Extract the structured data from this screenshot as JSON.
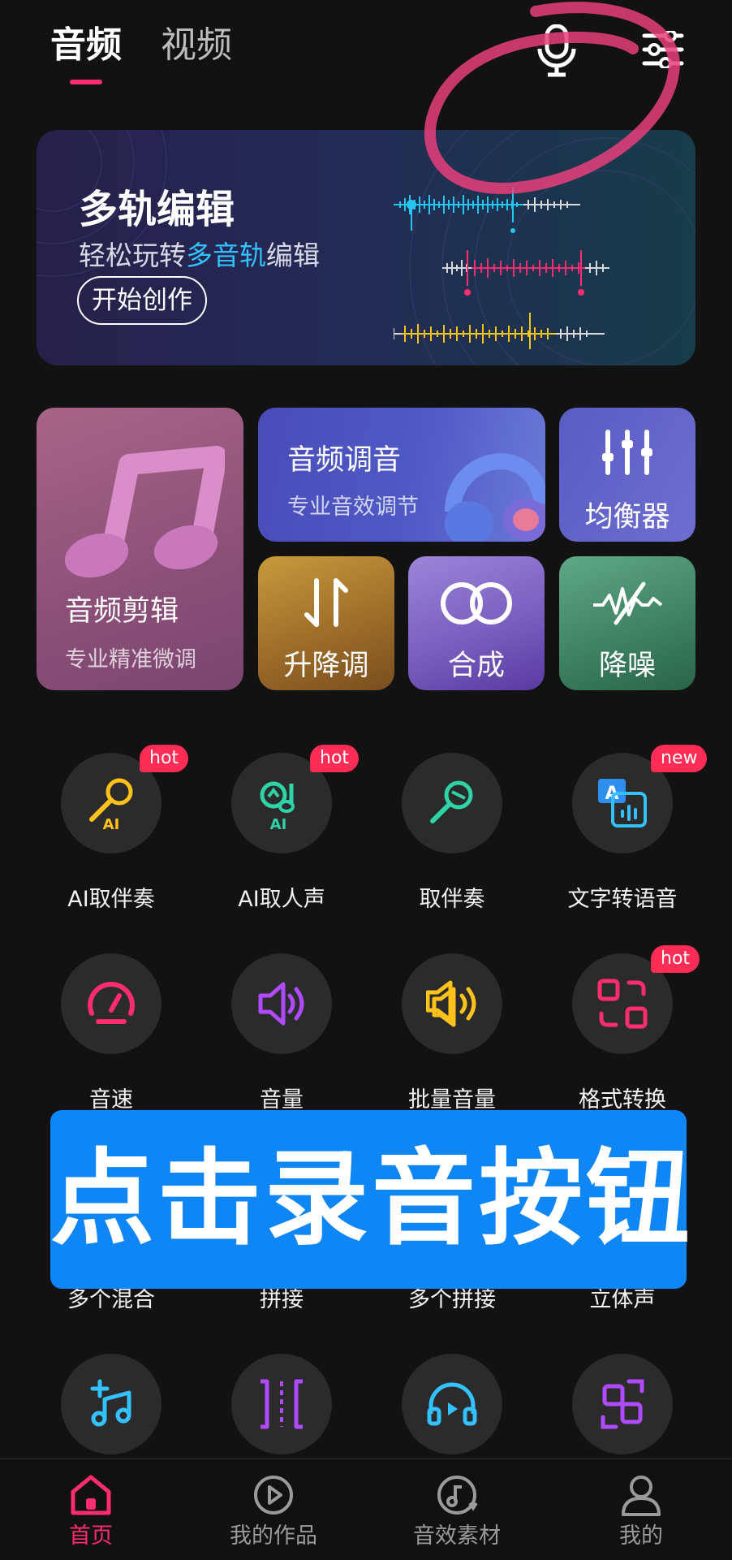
{
  "header": {
    "tabs": [
      {
        "label": "音频",
        "active": true
      },
      {
        "label": "视频",
        "active": false
      }
    ],
    "icons": [
      "microphone-icon",
      "settings-sliders-icon"
    ],
    "accent_color": "#ff2d6f",
    "annotation_circle_color": "#e8407a"
  },
  "banner": {
    "title": "多轨编辑",
    "subtitle_prefix": "轻松玩转",
    "subtitle_highlight": "多音轨",
    "subtitle_suffix": "编辑",
    "button_label": "开始创作",
    "track_colors": [
      "#27c6f0",
      "#ff2d6f",
      "#ffc21a"
    ]
  },
  "features": {
    "audio_edit": {
      "label": "音频剪辑",
      "sub": "专业精准微调"
    },
    "audio_tune": {
      "label": "音频调音",
      "sub": "专业音效调节"
    },
    "equalizer": {
      "label": "均衡器"
    },
    "pitch": {
      "label": "升降调"
    },
    "mix": {
      "label": "合成"
    },
    "denoise": {
      "label": "降噪"
    }
  },
  "tools": [
    {
      "label": "AI取伴奏",
      "badge": "hot",
      "icon": "ai-karaoke-mic-icon",
      "sub_icon_text": "AI"
    },
    {
      "label": "AI取人声",
      "badge": "hot",
      "icon": "ai-vocal-extract-icon",
      "sub_icon_text": "AI"
    },
    {
      "label": "取伴奏",
      "badge": "",
      "icon": "karaoke-mic-icon"
    },
    {
      "label": "文字转语音",
      "badge": "new",
      "icon": "text-to-speech-icon",
      "sub_icon_text": "A"
    },
    {
      "label": "音速",
      "badge": "",
      "icon": "speedometer-icon"
    },
    {
      "label": "音量",
      "badge": "",
      "icon": "volume-icon"
    },
    {
      "label": "批量音量",
      "badge": "",
      "icon": "batch-volume-icon"
    },
    {
      "label": "格式转换",
      "badge": "hot",
      "icon": "format-convert-icon"
    },
    {
      "label": "多个混合",
      "badge": "",
      "icon": "hidden"
    },
    {
      "label": "拼接",
      "badge": "",
      "icon": "hidden"
    },
    {
      "label": "多个拼接",
      "badge": "",
      "icon": "hidden"
    },
    {
      "label": "立体声",
      "badge": "",
      "icon": "hidden"
    },
    {
      "label": "",
      "badge": "",
      "icon": "add-music-icon"
    },
    {
      "label": "",
      "badge": "",
      "icon": "split-icon"
    },
    {
      "label": "",
      "badge": "",
      "icon": "headphone-play-icon"
    },
    {
      "label": "",
      "badge": "",
      "icon": "swap-convert-icon"
    }
  ],
  "overlay": {
    "text": "点击录音按钮",
    "color": "#0f86f5"
  },
  "bottom_nav": [
    {
      "label": "首页",
      "icon": "home-icon",
      "active": true
    },
    {
      "label": "我的作品",
      "icon": "play-circle-icon",
      "active": false
    },
    {
      "label": "音效素材",
      "icon": "music-download-icon",
      "active": false
    },
    {
      "label": "我的",
      "icon": "user-icon",
      "active": false
    }
  ]
}
